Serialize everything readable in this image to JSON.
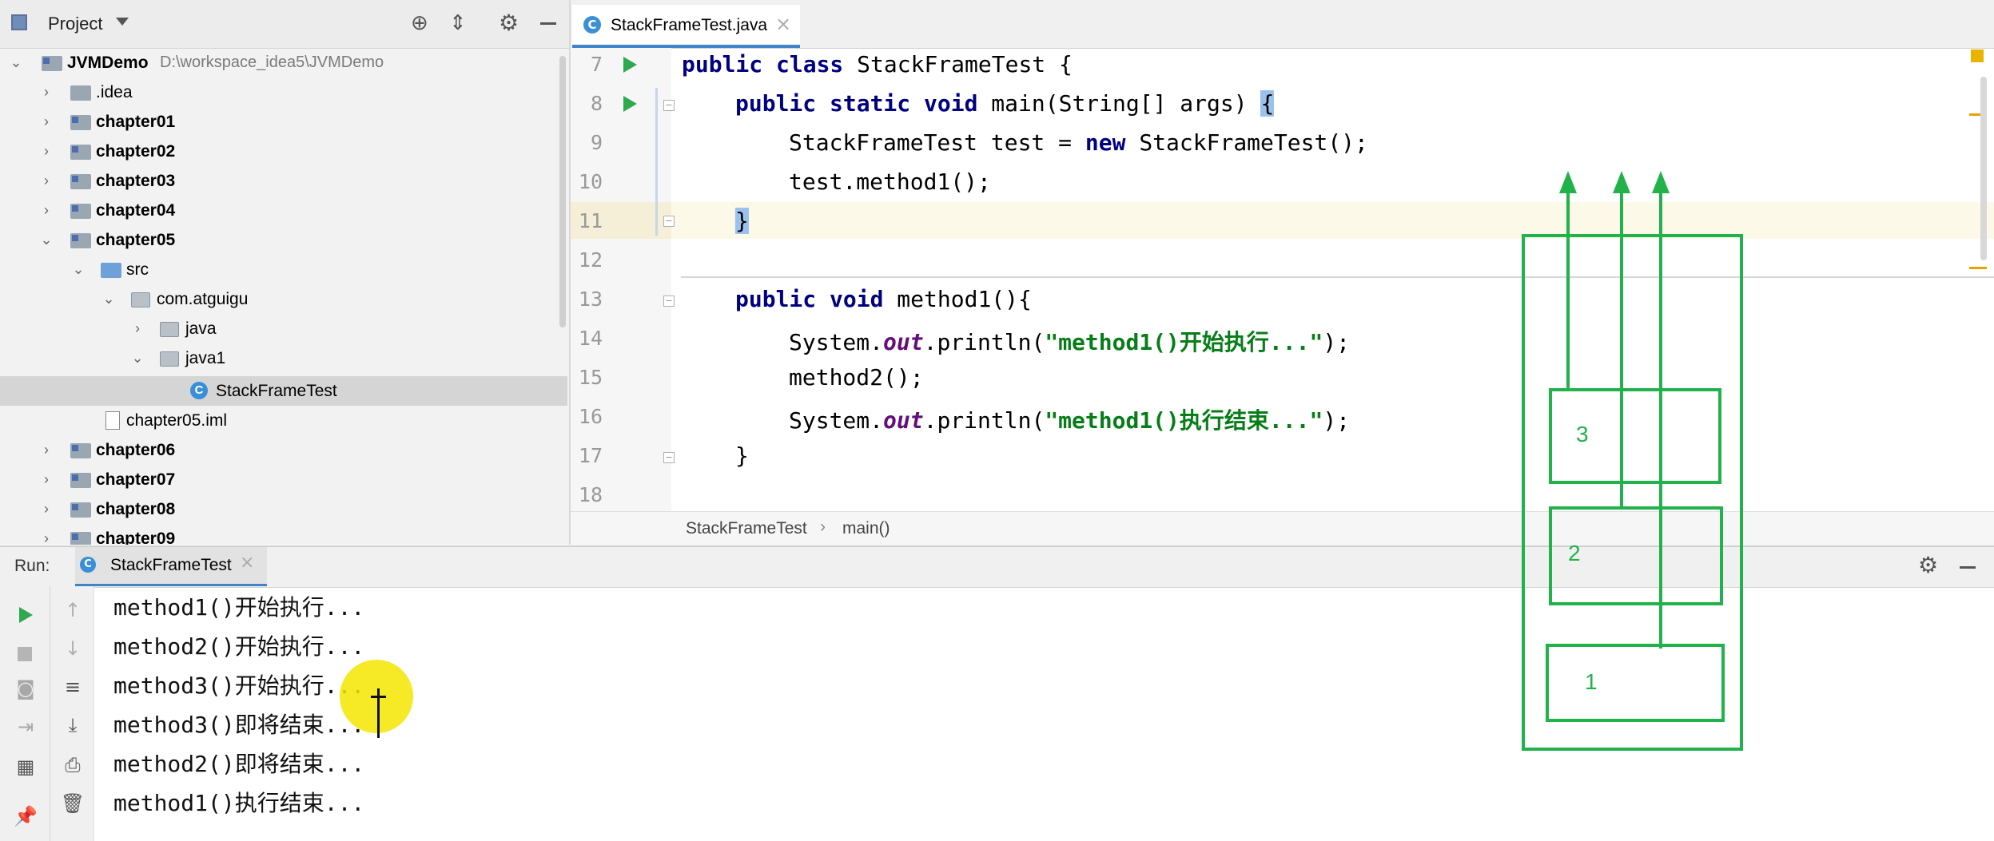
{
  "project": {
    "title": "Project",
    "root": {
      "name": "JVMDemo",
      "path": "D:\\workspace_idea5\\JVMDemo"
    },
    "items": [
      {
        "label": ".idea"
      },
      {
        "label": "chapter01"
      },
      {
        "label": "chapter02"
      },
      {
        "label": "chapter03"
      },
      {
        "label": "chapter04"
      },
      {
        "label": "chapter05"
      },
      {
        "label": "src"
      },
      {
        "label": "com.atguigu"
      },
      {
        "label": "java"
      },
      {
        "label": "java1"
      },
      {
        "label": "StackFrameTest"
      },
      {
        "label": "chapter05.iml"
      },
      {
        "label": "chapter06"
      },
      {
        "label": "chapter07"
      },
      {
        "label": "chapter08"
      },
      {
        "label": "chapter09"
      }
    ]
  },
  "editor": {
    "tab_label": "StackFrameTest.java",
    "line_numbers": [
      "7",
      "8",
      "9",
      "10",
      "11",
      "12",
      "13",
      "14",
      "15",
      "16",
      "17",
      "18"
    ],
    "code": {
      "l7_kw": "public class ",
      "l7_rest": "StackFrameTest {",
      "l8_kw": "public static void ",
      "l8_rest": "main(String[] args) ",
      "l8_brace": "{",
      "l9_a": "StackFrameTest test = ",
      "l9_kw": "new ",
      "l9_b": "StackFrameTest();",
      "l10": "test.method1();",
      "l11": "}",
      "l13_kw": "public void ",
      "l13_rest": "method1(){",
      "l14_a": "System.",
      "l14_out": "out",
      "l14_b": ".println(",
      "l14_str": "\"method1()开始执行...\"",
      "l14_c": ");",
      "l15": "method2();",
      "l16_a": "System.",
      "l16_out": "out",
      "l16_b": ".println(",
      "l16_str": "\"method1()执行结束...\"",
      "l16_c": ");",
      "l17": "}"
    },
    "breadcrumb": [
      "StackFrameTest",
      "main()"
    ]
  },
  "run": {
    "label": "Run:",
    "tab_label": "StackFrameTest",
    "output": [
      "method1()开始执行...",
      "method2()开始执行...",
      "method3()开始执行...",
      "method3()即将结束...",
      "method2()即将结束...",
      "method1()执行结束..."
    ]
  },
  "annotation": {
    "stroke": "#22b24c",
    "frame_labels": [
      "3",
      "2",
      "1"
    ]
  },
  "colors": {
    "accent": "#4083c9",
    "run_green": "#2fa84f",
    "highlight_line": "#fcf9e8",
    "cursor_dot": "#f5e600"
  }
}
